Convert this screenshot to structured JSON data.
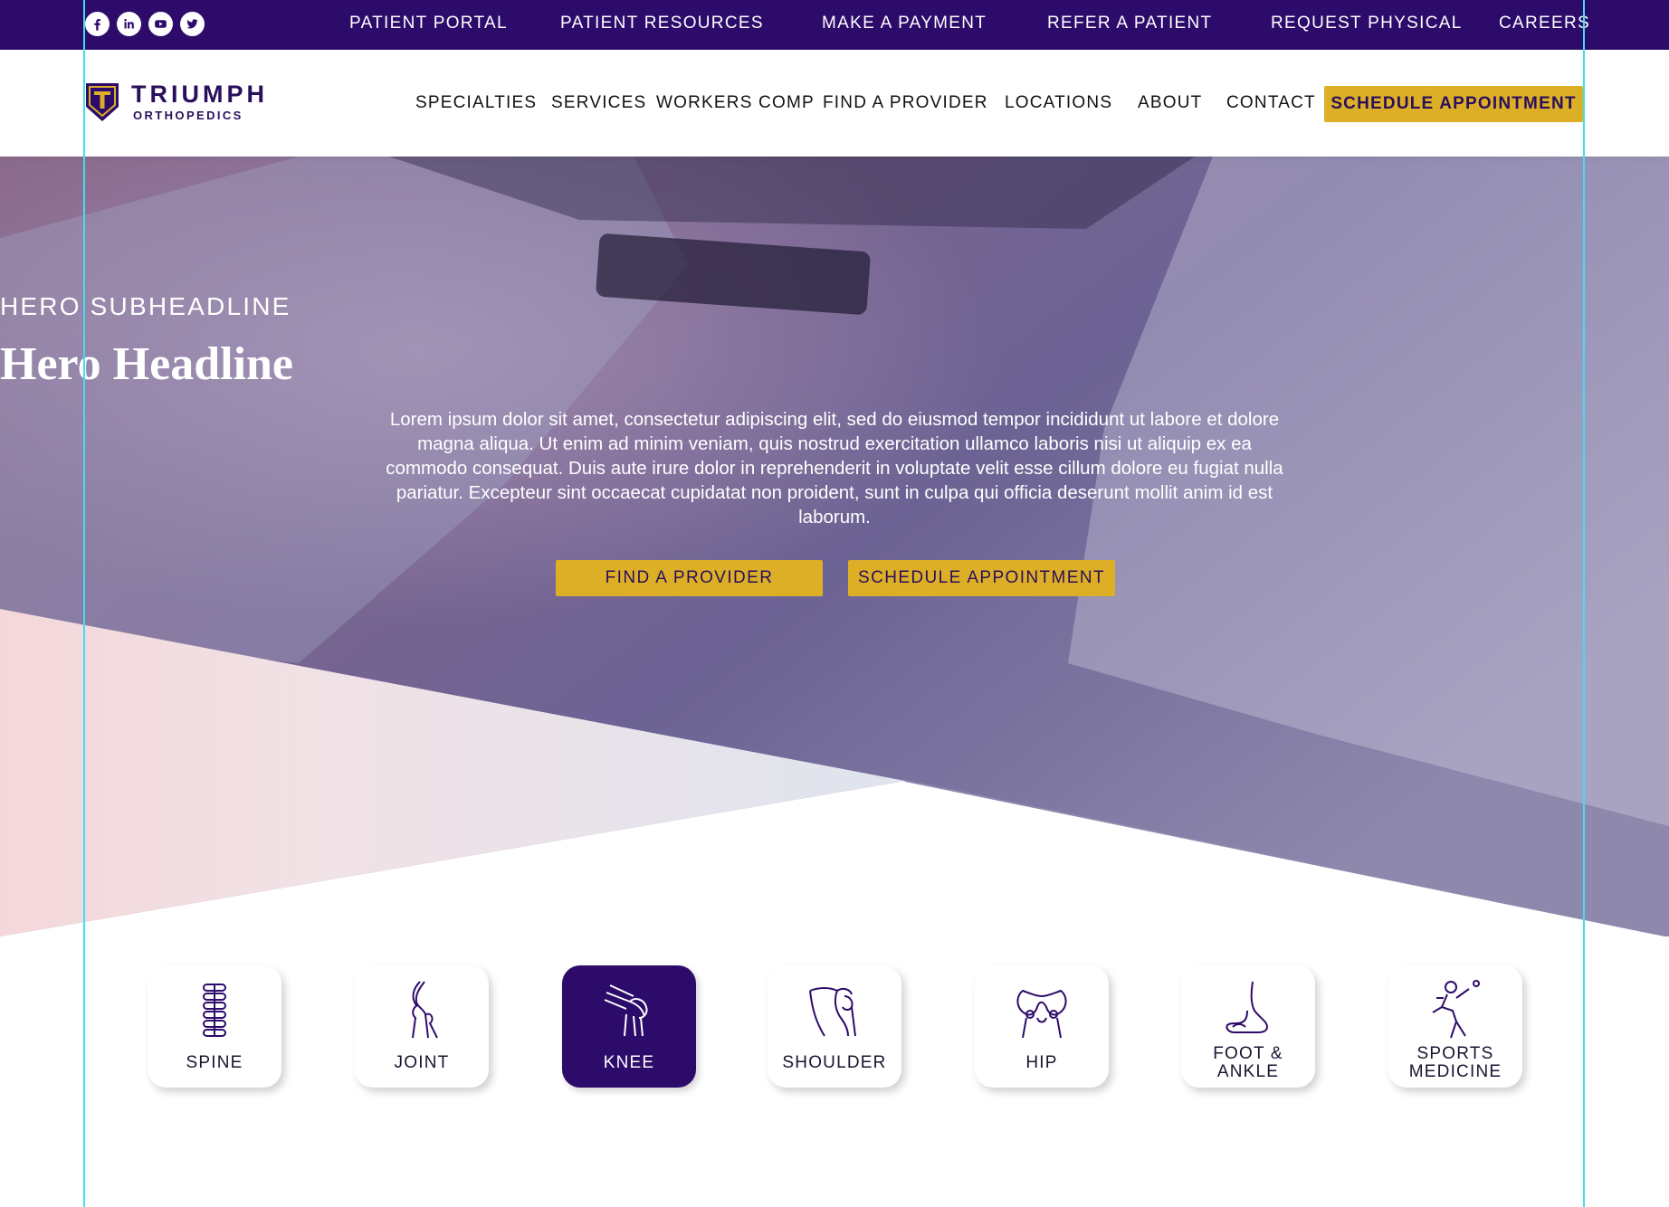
{
  "utility_bar": {
    "social": [
      {
        "icon": "facebook-icon"
      },
      {
        "icon": "linkedin-icon"
      },
      {
        "icon": "youtube-icon"
      },
      {
        "icon": "twitter-icon"
      }
    ],
    "links": [
      "PATIENT PORTAL",
      "PATIENT RESOURCES",
      "MAKE A PAYMENT",
      "REFER A PATIENT",
      "REQUEST PHYSICAL",
      "CAREERS"
    ]
  },
  "header": {
    "logo_title": "TRIUMPH",
    "logo_subtitle": "ORTHOPEDICS",
    "nav": [
      "SPECIALTIES",
      "SERVICES",
      "WORKERS COMP",
      "FIND A PROVIDER",
      "LOCATIONS",
      "ABOUT",
      "CONTACT"
    ],
    "cta": "SCHEDULE APPOINTMENT"
  },
  "hero": {
    "subheadline": "HERO SUBHEADLINE",
    "headline": "Hero Headline",
    "body": "Lorem ipsum dolor sit amet, consectetur adipiscing elit, sed do eiusmod tempor incididunt ut labore et dolore magna aliqua. Ut enim ad minim veniam, quis nostrud exercitation ullamco laboris nisi ut aliquip ex ea commodo consequat. Duis aute irure dolor in reprehenderit in voluptate velit esse cillum dolore eu fugiat nulla pariatur. Excepteur sint occaecat cupidatat non proident, sunt in culpa qui officia deserunt mollit anim id est laborum.",
    "buttons": [
      "FIND A PROVIDER",
      "SCHEDULE APPOINTMENT"
    ]
  },
  "specialties": [
    {
      "label": "SPINE",
      "icon": "spine-icon",
      "active": false
    },
    {
      "label": "JOINT",
      "icon": "joint-icon",
      "active": false
    },
    {
      "label": "KNEE",
      "icon": "knee-icon",
      "active": true
    },
    {
      "label": "SHOULDER",
      "icon": "shoulder-icon",
      "active": false
    },
    {
      "label": "HIP",
      "icon": "hip-icon",
      "active": false
    },
    {
      "label": "FOOT & ANKLE",
      "icon": "foot-ankle-icon",
      "active": false
    },
    {
      "label": "SPORTS MEDICINE",
      "icon": "sports-medicine-icon",
      "active": false
    }
  ],
  "colors": {
    "brand_purple": "#2d0b6b",
    "accent_gold": "#dcaf26",
    "guide_cyan": "#3fe0ee"
  }
}
